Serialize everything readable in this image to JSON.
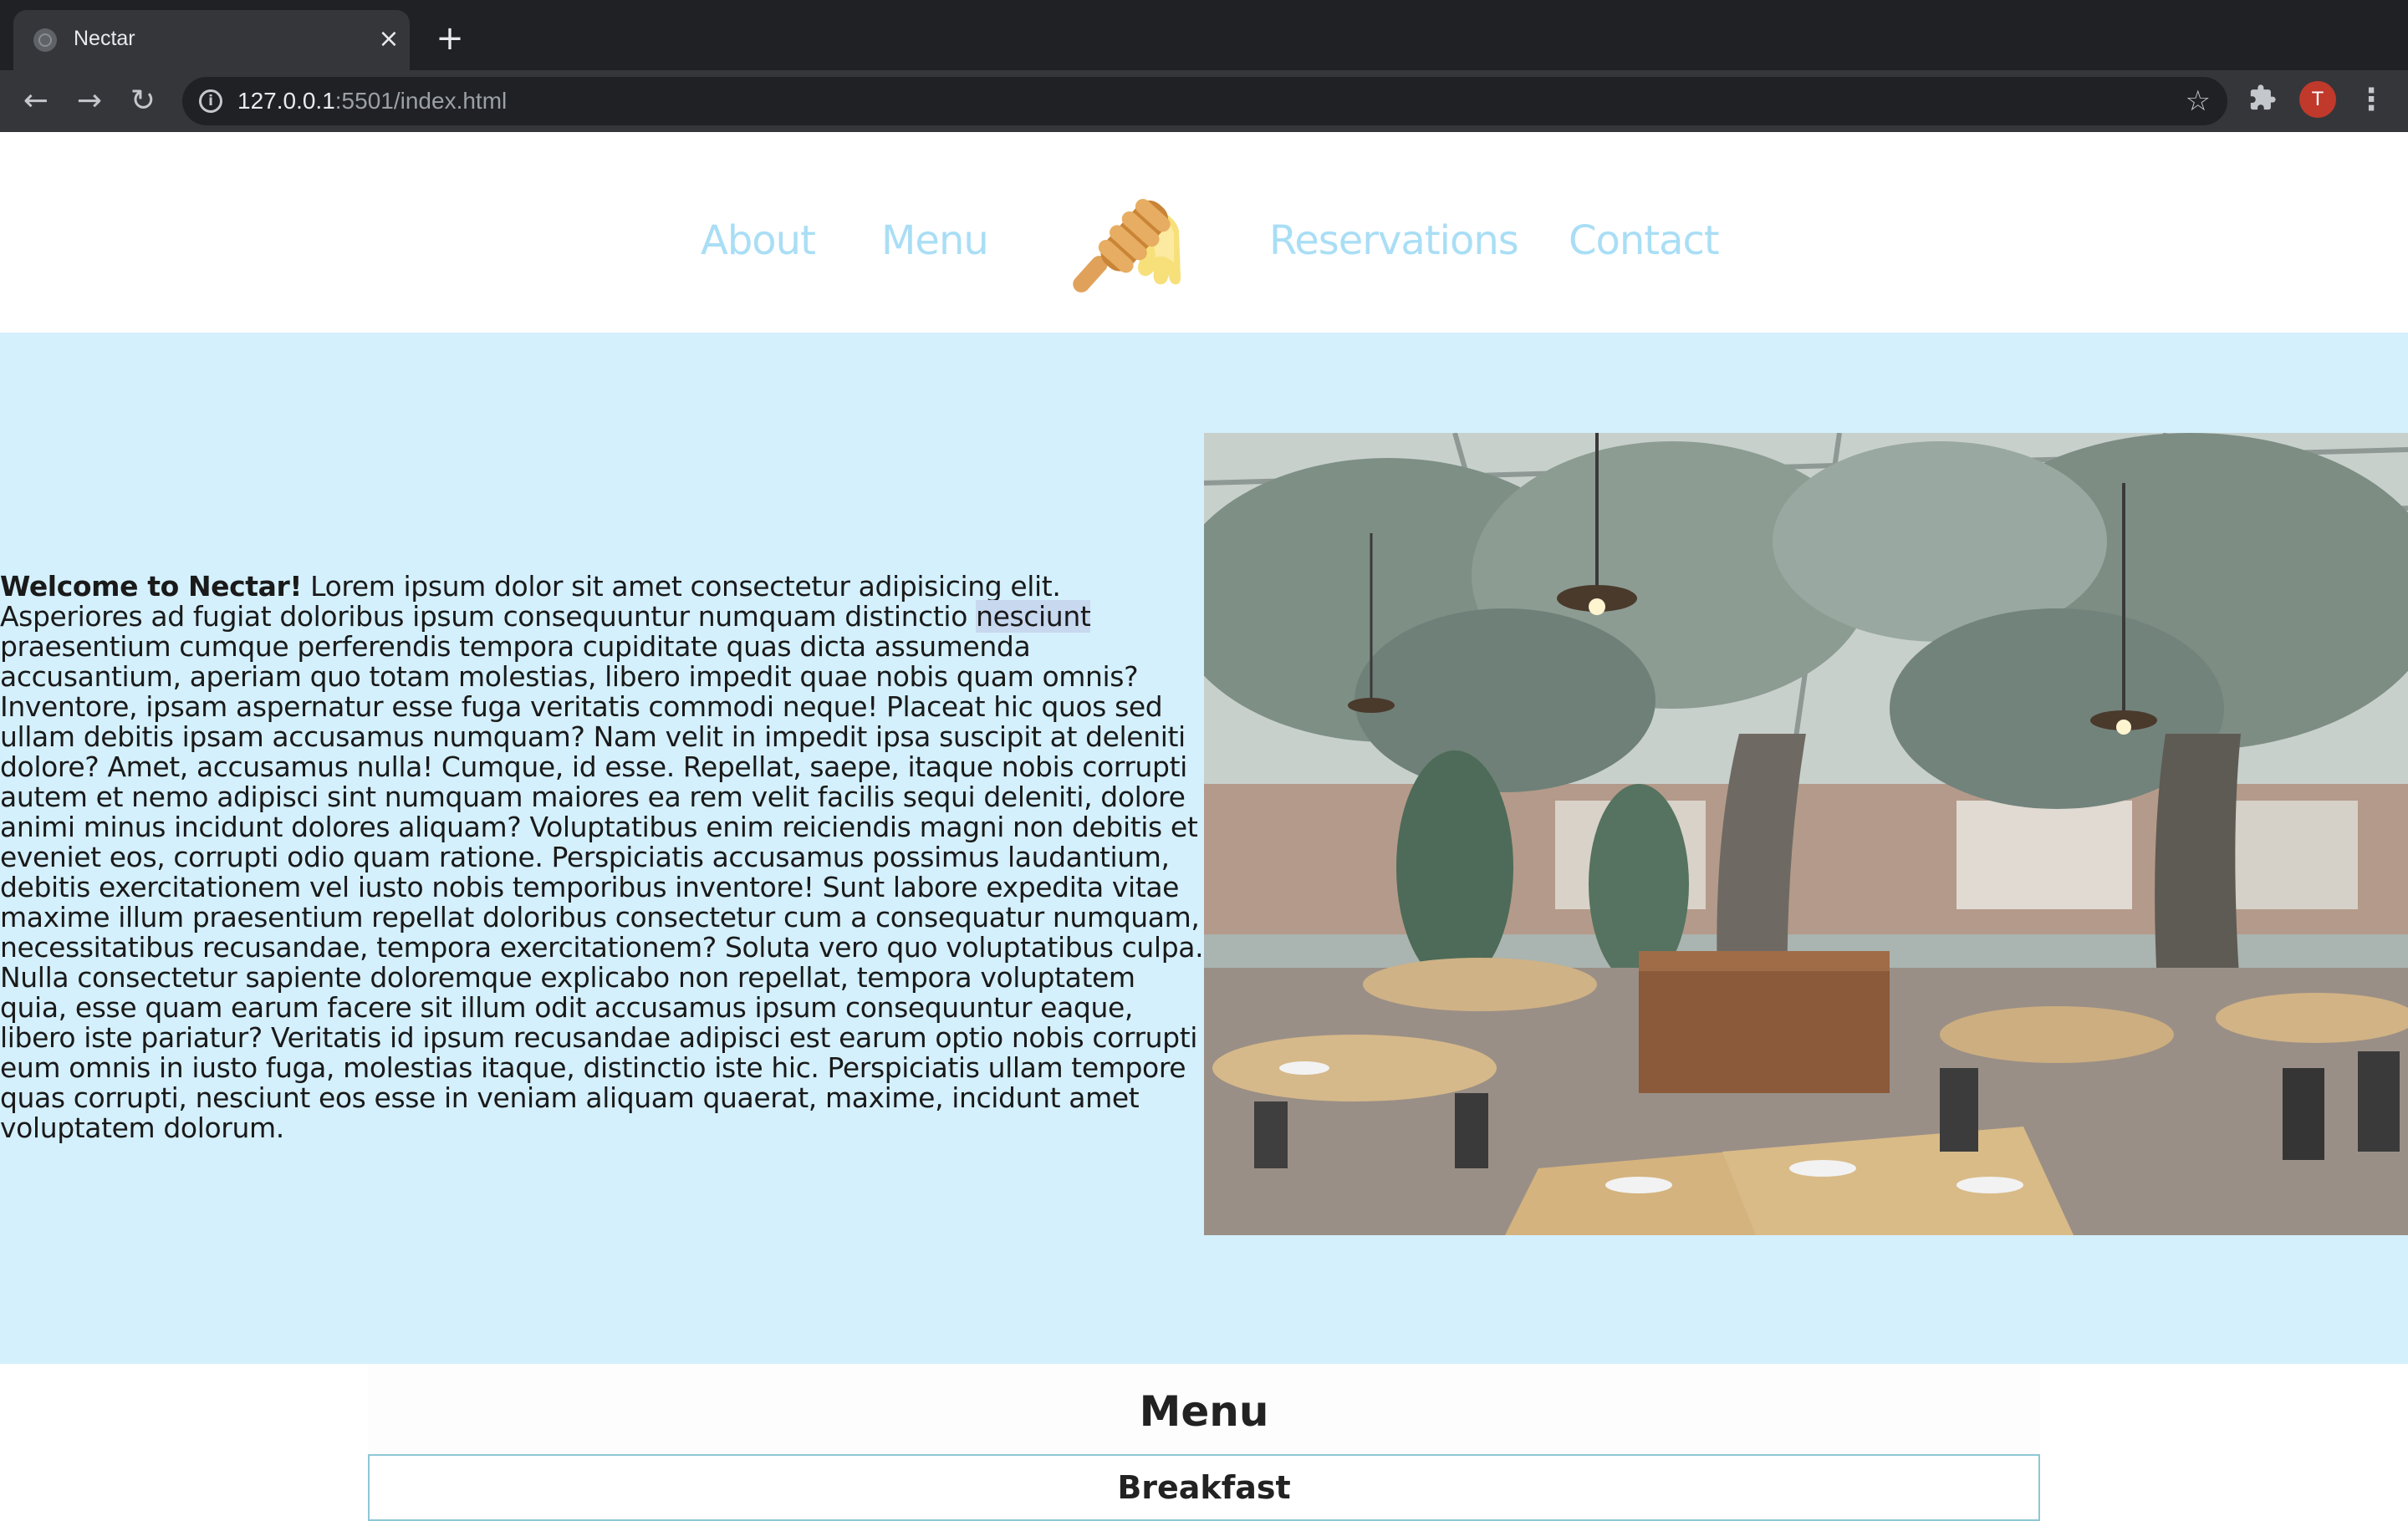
{
  "browser": {
    "tab_title": "Nectar",
    "url_host": "127.0.0.1",
    "url_rest": ":5501/index.html",
    "avatar_letter": "T",
    "icons": {
      "back": "arrow-left-icon",
      "forward": "arrow-right-icon",
      "reload": "reload-icon",
      "info": "info-icon",
      "bookmark": "star-icon",
      "extensions": "puzzle-icon",
      "menu": "kebab-menu-icon",
      "close_tab": "close-icon",
      "new_tab": "plus-icon"
    }
  },
  "nav": {
    "items": [
      {
        "label": "About"
      },
      {
        "label": "Menu"
      },
      {
        "label": "Reservations"
      },
      {
        "label": "Contact"
      }
    ],
    "logo": "honey-dipper-logo",
    "link_color": "#a9def5"
  },
  "hero": {
    "welcome": "Welcome to Nectar!",
    "body_before": " Lorem ipsum dolor sit amet consectetur adipisicing elit. Asperiores ad fugiat doloribus ipsum consequuntur numquam distinctio ",
    "highlighted_word": "nesciunt",
    "body_after": " praesentium cumque perferendis tempora cupiditate quas dicta assumenda accusantium, aperiam quo totam molestias, libero impedit quae nobis quam omnis? Inventore, ipsam aspernatur esse fuga veritatis commodi neque! Placeat hic quos sed ullam debitis ipsam accusamus numquam? Nam velit in impedit ipsa suscipit at deleniti dolore? Amet, accusamus nulla! Cumque, id esse. Repellat, saepe, itaque nobis corrupti autem et nemo adipisci sint numquam maiores ea rem velit facilis sequi deleniti, dolore animi minus incidunt dolores aliquam? Voluptatibus enim reiciendis magni non debitis et eveniet eos, corrupti odio quam ratione. Perspiciatis accusamus possimus laudantium, debitis exercitationem vel iusto nobis temporibus inventore! Sunt labore expedita vitae maxime illum praesentium repellat doloribus consectetur cum a consequatur numquam, necessitatibus recusandae, tempora exercitationem? Soluta vero quo voluptatibus culpa. Nulla consectetur sapiente doloremque explicabo non repellat, tempora voluptatem quia, esse quam earum facere sit illum odit accusamus ipsum consequuntur eaque, libero iste pariatur? Veritatis id ipsum recusandae adipisci est earum optio nobis corrupti eum omnis in iusto fuga, molestias itaque, distinctio iste hic. Perspiciatis ullam tempore quas corrupti, nesciunt eos esse in veniam aliquam quaerat, maxime, incidunt amet voluptatem dolorum.",
    "background_color": "#d4f0fc"
  },
  "menu_section": {
    "title": "Menu",
    "first_category": "Breakfast"
  }
}
